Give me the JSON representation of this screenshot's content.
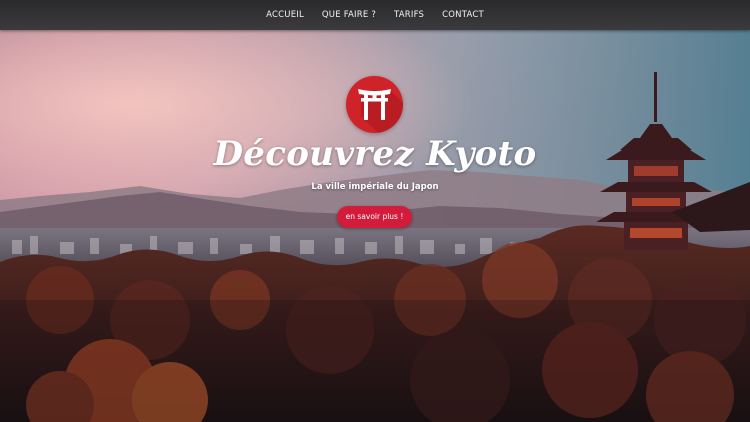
{
  "nav": {
    "items": [
      {
        "label": "ACCUEIL"
      },
      {
        "label": "QUE FAIRE ?"
      },
      {
        "label": "TARIFS"
      },
      {
        "label": "CONTACT"
      }
    ]
  },
  "hero": {
    "title": "Découvrez Kyoto",
    "subtitle": "La ville impériale du Japon",
    "cta_label": "en savoir plus !",
    "logo_icon": "torii-gate-icon",
    "background_image": "kyoto-sunset-pagoda-cityscape"
  },
  "colors": {
    "nav_bg": "#333335",
    "logo_red": "#cf2229",
    "cta_red": "#d31b3c",
    "text": "#ffffff"
  }
}
